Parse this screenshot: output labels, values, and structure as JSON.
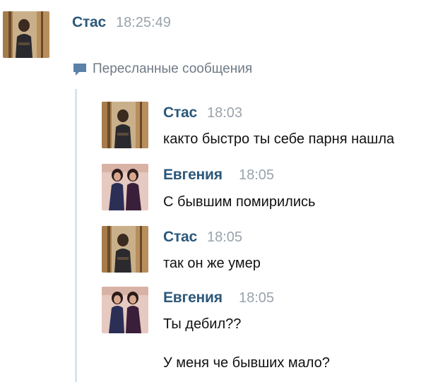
{
  "top_message": {
    "author": "Стас",
    "time": "18:25:49",
    "forward_label": "Пересланные сообщения",
    "forward_icon": "speech-bubble-icon",
    "avatar_icon": "user-avatar-stas"
  },
  "forwarded": [
    {
      "author": "Стас",
      "time": "18:03",
      "lines": [
        "както быстро ты себе парня нашла"
      ],
      "avatar_icon": "user-avatar-stas"
    },
    {
      "author": "Евгения",
      "time": "18:05",
      "lines": [
        "С бывшим помирились"
      ],
      "avatar_icon": "user-avatar-evgeniya"
    },
    {
      "author": "Стас",
      "time": "18:05",
      "lines": [
        "так он же умер"
      ],
      "avatar_icon": "user-avatar-stas"
    },
    {
      "author": "Евгения",
      "time": "18:05",
      "lines": [
        "Ты дебил??",
        "У меня че бывших мало?"
      ],
      "avatar_icon": "user-avatar-evgeniya"
    }
  ],
  "colors": {
    "author": "#2b587a",
    "time": "#9aa3ab",
    "forward_text": "#6f7a86",
    "forward_bar": "#dbe3ea"
  }
}
